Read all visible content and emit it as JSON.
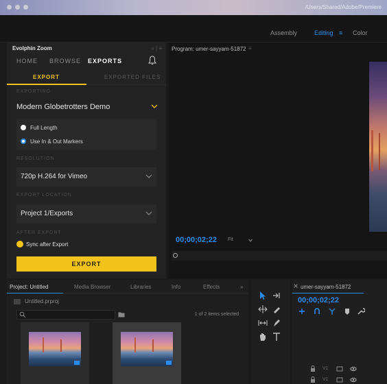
{
  "workspaces": [
    "Assembly",
    "Editing",
    "Color"
  ],
  "mac_path": "/Users/Shared/Adobe/Premiere",
  "plugin": {
    "title": "Evolphin Zoom",
    "nav": [
      "HOME",
      "BROWSE",
      "EXPORTS"
    ],
    "subtabs": [
      "EXPORT",
      "EXPORTED FILES"
    ],
    "exporting_label": "EXPORTING",
    "exporting_value": "Modern Globetrotters Demo",
    "radio_full": "Full Length",
    "radio_inout": "Use In & Out Markers",
    "resolution_label": "RESOLUTION",
    "resolution_value": "720p H.264 for Vimeo",
    "location_label": "EXPORT LOCATION",
    "location_value": "Project 1/Exports",
    "after_label": "AFTER EXPORT",
    "sync_label": "Sync after Export",
    "export_button": "EXPORT"
  },
  "program": {
    "title": "Program: umer-sayyam-51872",
    "timecode": "00;00;02;22",
    "fit": "Fit"
  },
  "project": {
    "tabs": [
      "Project: Untitled",
      "Media Browser",
      "Libraries",
      "Info",
      "Effects"
    ],
    "overflow": "»",
    "file": "Untitled.prproj",
    "selection": "1 of 2 items selected"
  },
  "timeline": {
    "title": "umer-sayyam-51872",
    "timecode": "00;00;02;22",
    "tracks": [
      "V1",
      "V1"
    ]
  },
  "colors": {
    "accent": "#2d8ceb",
    "yellow": "#f2c41b"
  }
}
